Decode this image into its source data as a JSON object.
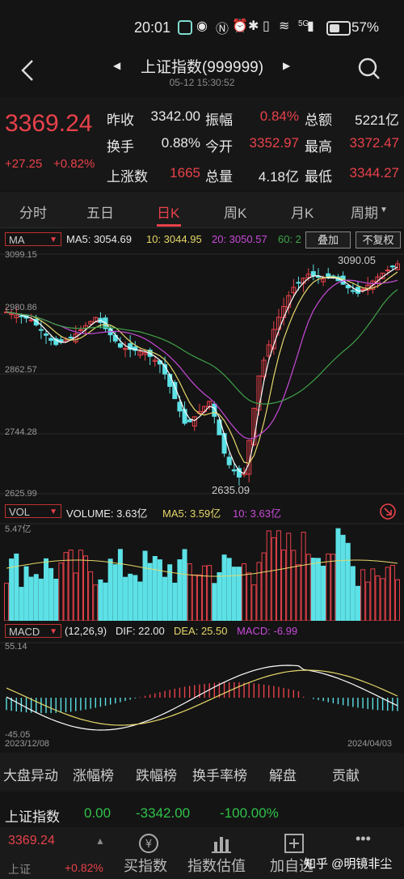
{
  "status_bar": {
    "time": "20:01",
    "battery": "57%",
    "signal_label": "5G"
  },
  "header": {
    "title": "上证指数(999999)",
    "datetime": "05-12 15:30:52"
  },
  "quote": {
    "price": "3369.24",
    "change": "+27.25",
    "change_pct": "+0.82%",
    "fields": [
      {
        "label": "昨收",
        "value": "3342.00",
        "color": "white"
      },
      {
        "label": "振幅",
        "value": "0.84%",
        "color": "red"
      },
      {
        "label": "总额",
        "value": "5221亿",
        "color": "white"
      },
      {
        "label": "换手",
        "value": "0.88%",
        "color": "white"
      },
      {
        "label": "今开",
        "value": "3352.97",
        "color": "red"
      },
      {
        "label": "最高",
        "value": "3372.47",
        "color": "red"
      },
      {
        "label": "上涨数",
        "value": "1665",
        "color": "red"
      },
      {
        "label": "总量",
        "value": "4.18亿",
        "color": "white"
      },
      {
        "label": "最低",
        "value": "3344.27",
        "color": "red"
      }
    ]
  },
  "period_tabs": [
    "分时",
    "五日",
    "日K",
    "周K",
    "月K",
    "周期"
  ],
  "active_period": "日K",
  "kline": {
    "indicator": "MA",
    "ma5": "MA5: 3054.69",
    "ma10": "10: 3044.95",
    "ma20": "20: 3050.57",
    "ma60": "60: 2",
    "overlay_button": "叠加",
    "adjust_button": "不复权",
    "y_labels": [
      "3099.15",
      "2980.86",
      "2862.57",
      "2744.28",
      "2625.99"
    ],
    "high_mark": "3090.05",
    "low_mark": "2635.09"
  },
  "volume": {
    "indicator": "VOL",
    "volume": "VOLUME: 3.63亿",
    "ma5": "MA5: 3.59亿",
    "ma10": "10: 3.63亿",
    "y_label": "5.47亿"
  },
  "macd": {
    "indicator": "MACD",
    "params": "(12,26,9)",
    "dif": "DIF: 22.00",
    "dea": "DEA: 25.50",
    "macd": "MACD: -6.99",
    "y_top": "55.14",
    "y_bottom": "-45.05",
    "date_start": "2023/12/08",
    "date_end": "2024/04/03"
  },
  "bottom_tabs": [
    "大盘异动",
    "涨幅榜",
    "跌幅榜",
    "换手率榜",
    "解盘",
    "贡献"
  ],
  "active_bottom_tab": "大盘异动",
  "index_row": {
    "name": "上证指数",
    "price": "0.00",
    "change": "-3342.00",
    "pct": "-100.00%"
  },
  "footer": {
    "name": "上证",
    "price": "3369.24",
    "pct": "+0.82%",
    "buttons": [
      "买指数",
      "指数估值",
      "加自选"
    ],
    "watermark": "知乎 @明镜非尘",
    "more": "•••"
  },
  "colors": {
    "up": "#e8414a",
    "down": "#2fc24a",
    "candle_down": "#5ce1e6",
    "ma5": "#ffffff",
    "ma10": "#e6d86a",
    "ma20": "#c84ad8",
    "ma60": "#3fa24a"
  }
}
